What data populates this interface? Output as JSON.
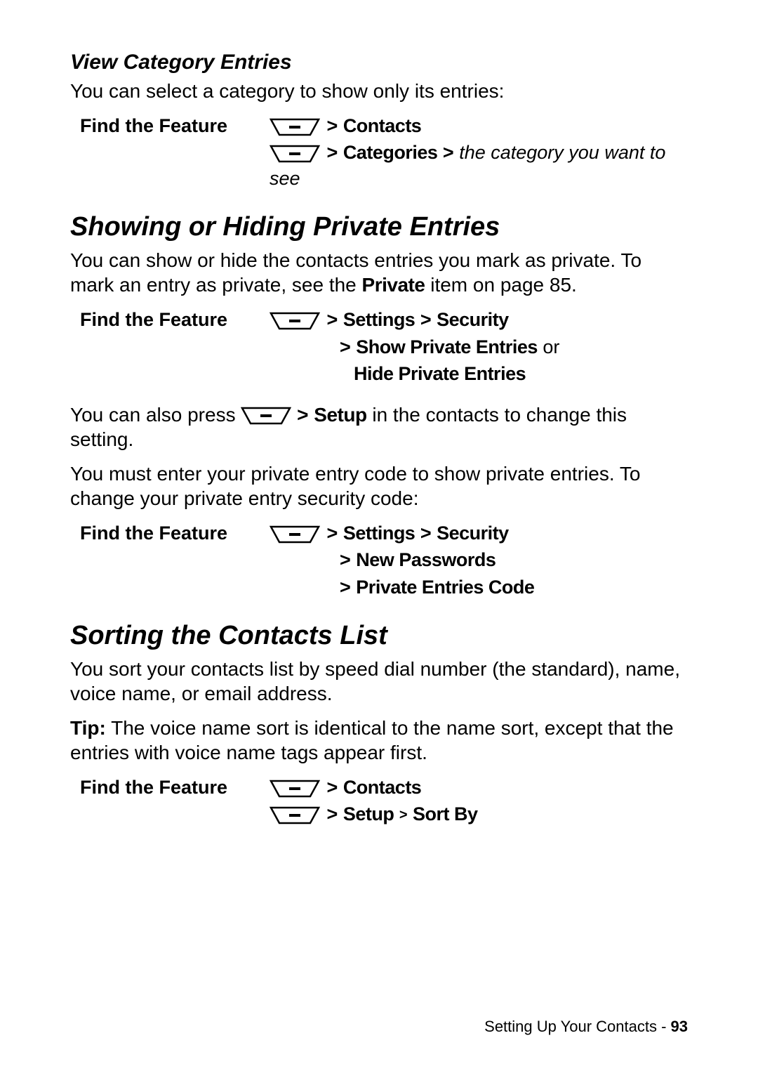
{
  "section1": {
    "subheading": "View Category Entries",
    "para": "You can select a category to show only its entries:",
    "findLabel": "Find the Feature",
    "line1_item": "Contacts",
    "line2_item": "Categories",
    "line2_tail": "the category you want to see"
  },
  "section2": {
    "heading": "Showing or Hiding Private Entries",
    "para_a": "You can show or hide the contacts entries you mark as private. To mark an entry as private, see the ",
    "para_a_cond": "Private",
    "para_a_tail": " item on page 85.",
    "findLabel": "Find the Feature",
    "p1_l1_a": "Settings",
    "p1_l1_b": "Security",
    "p1_l2_a": "Show Private Entries",
    "p1_l2_or": " or",
    "p1_l3": "Hide Private Entries",
    "para_b_pre": "You can also press ",
    "para_b_item": "Setup",
    "para_b_post": " in the contacts to change this setting.",
    "para_c": "You must enter your private entry code to show private entries. To change your private entry security code:",
    "p2_l1_a": "Settings",
    "p2_l1_b": "Security",
    "p2_l2": "New Passwords",
    "p2_l3": "Private Entries Code"
  },
  "section3": {
    "heading": "Sorting the Contacts List",
    "para": "You sort your contacts list by speed dial number (the standard), name, voice name, or email address.",
    "tipLabel": "Tip:",
    "tipBody": " The voice name sort is identical to the name sort, except that the entries with voice name tags appear first.",
    "findLabel": "Find the Feature",
    "l1": "Contacts",
    "l2_a": "Setup",
    "l2_b": "Sort By"
  },
  "footer": {
    "text": "Setting Up Your Contacts - ",
    "page": "93"
  },
  "gt": ">"
}
